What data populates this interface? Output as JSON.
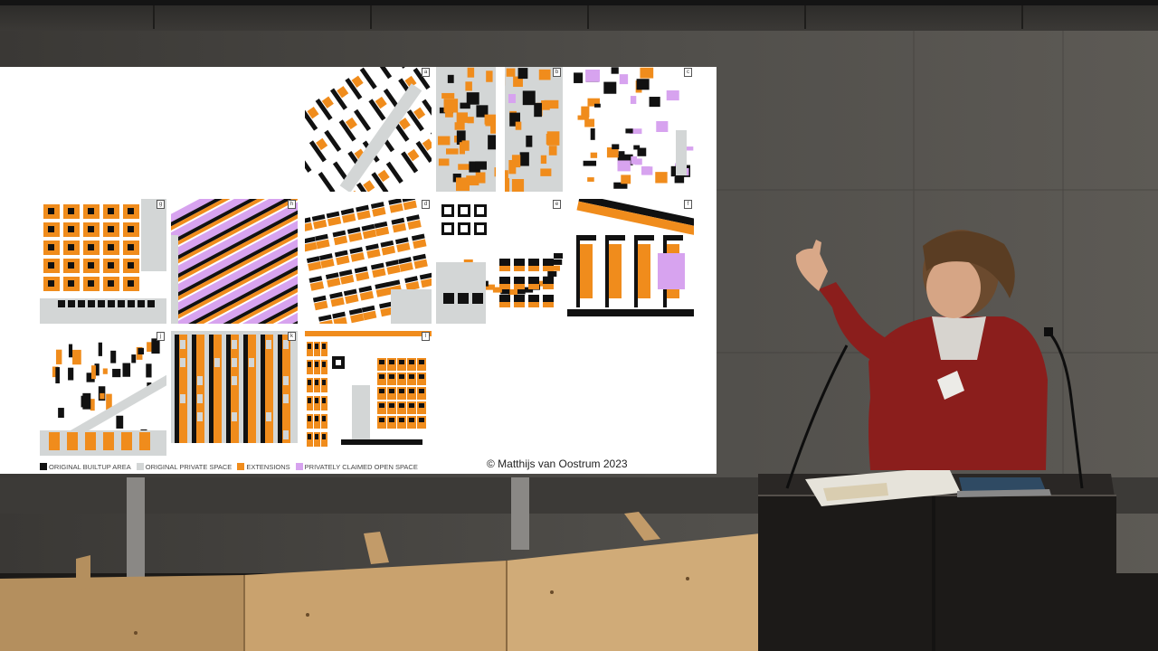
{
  "slide": {
    "tile_letters": [
      "a",
      "b",
      "c",
      "g",
      "h",
      "d",
      "e",
      "f",
      "j",
      "k",
      "l"
    ],
    "legend": [
      {
        "label": "ORIGINAL BUILTUP AREA",
        "color": "#111111"
      },
      {
        "label": "ORIGINAL PRIVATE SPACE",
        "color": "#d3d6d6"
      },
      {
        "label": "EXTENSIONS",
        "color": "#f08c1c"
      },
      {
        "label": "PRIVATELY CLAIMED OPEN SPACE",
        "color": "#d7a3ef"
      }
    ],
    "credit": "© Matthijs van Oostrum 2023"
  },
  "colors": {
    "builtup": "#111111",
    "private": "#d3d6d6",
    "extension": "#f08c1c",
    "claimed": "#d7a3ef",
    "wall": "#4b4a46",
    "plywood": "#c9a26e",
    "shirt": "#8b1e1c"
  }
}
